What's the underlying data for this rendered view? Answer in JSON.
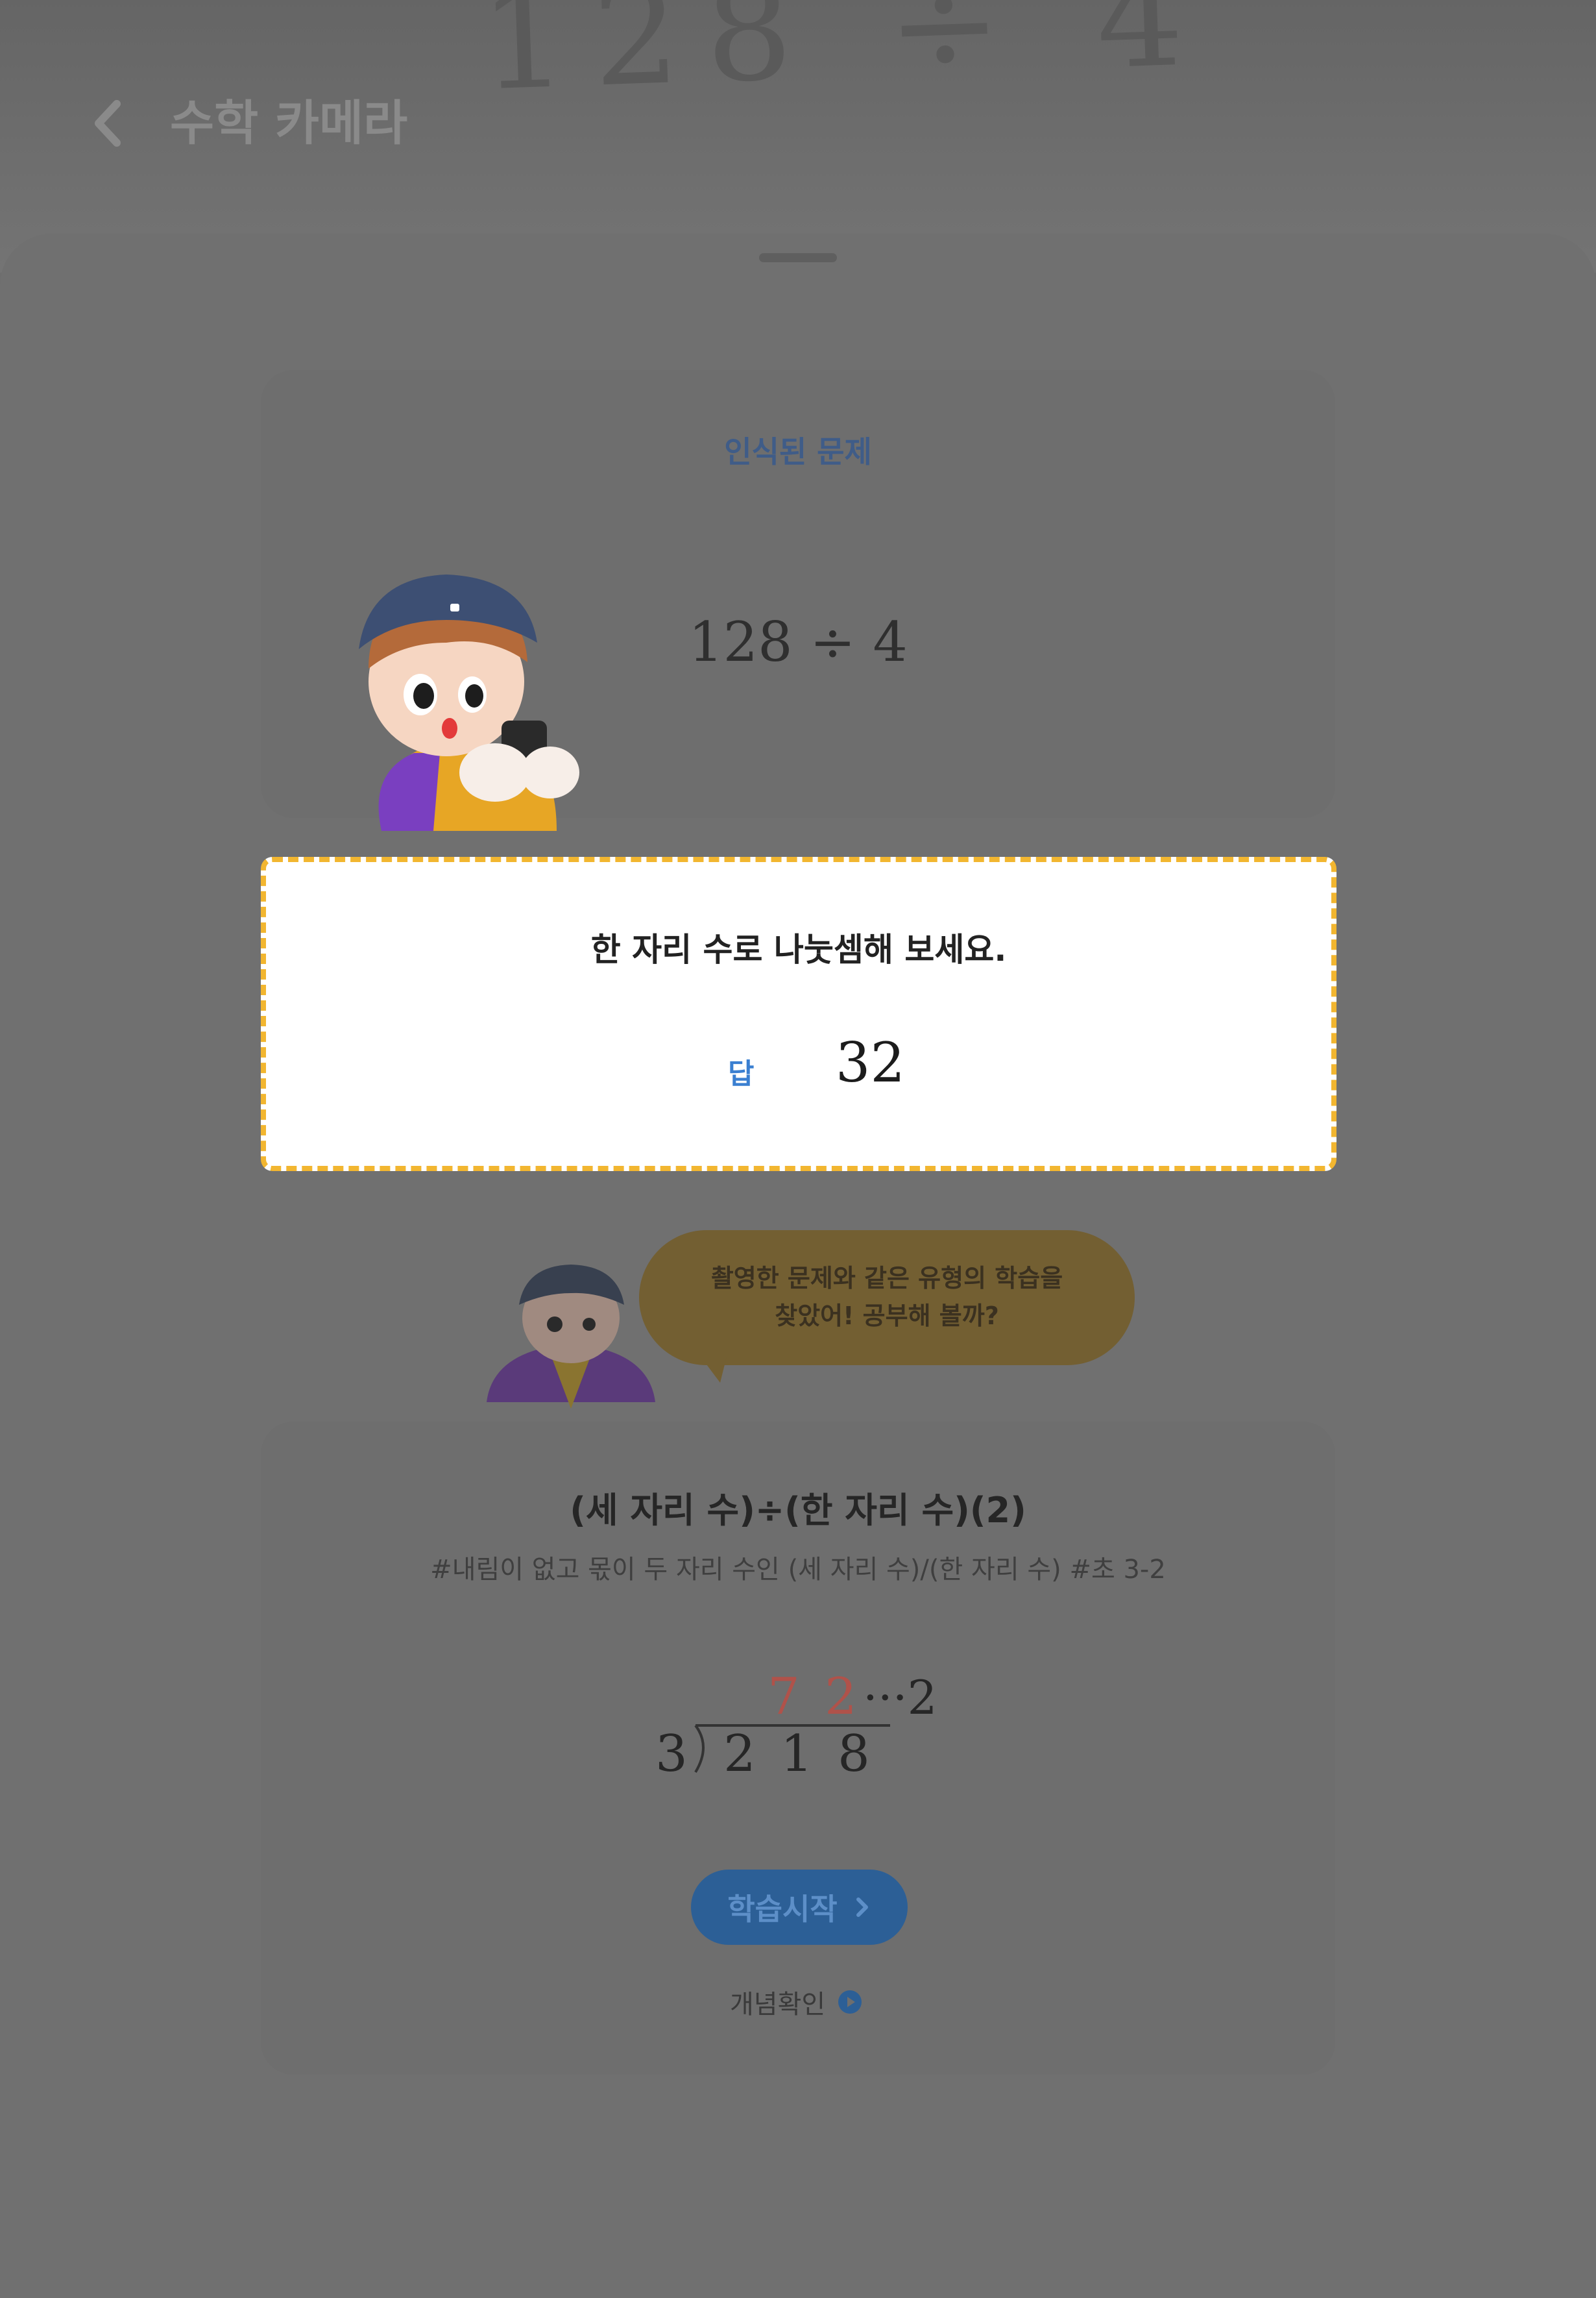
{
  "header": {
    "camera_preview_text": "128 ÷ 4",
    "title": "수학 카메라",
    "back_icon": "chevron-left-icon"
  },
  "recognized": {
    "title": "인식된 문제",
    "expression": "128  ÷  4"
  },
  "answer_box": {
    "question": "한 자리 수로 나눗셈해 보세요.",
    "answer_label": "답",
    "answer_value": "32"
  },
  "bubble": {
    "text": "촬영한 문제와 같은 유형의 학습을\n찾았어! 공부해 볼까?"
  },
  "lesson": {
    "title": "(세 자리 수)÷(한 자리 수)(2)",
    "tags": "#내림이 없고 몫이 두 자리 수인 (세 자리 수)/(한 자리 수) #초 3-2",
    "division": {
      "divisor": "3",
      "dividend": [
        "2",
        "1",
        "8"
      ],
      "quotient": [
        "7",
        "2"
      ],
      "remainder": "···2"
    },
    "start_button": "학습시작",
    "concept_link": "개념확인"
  },
  "colors": {
    "answer_border": "#f2b630",
    "answer_label": "#3a7fd1",
    "quotient": "#b0524a",
    "button": "#2c5f96"
  }
}
